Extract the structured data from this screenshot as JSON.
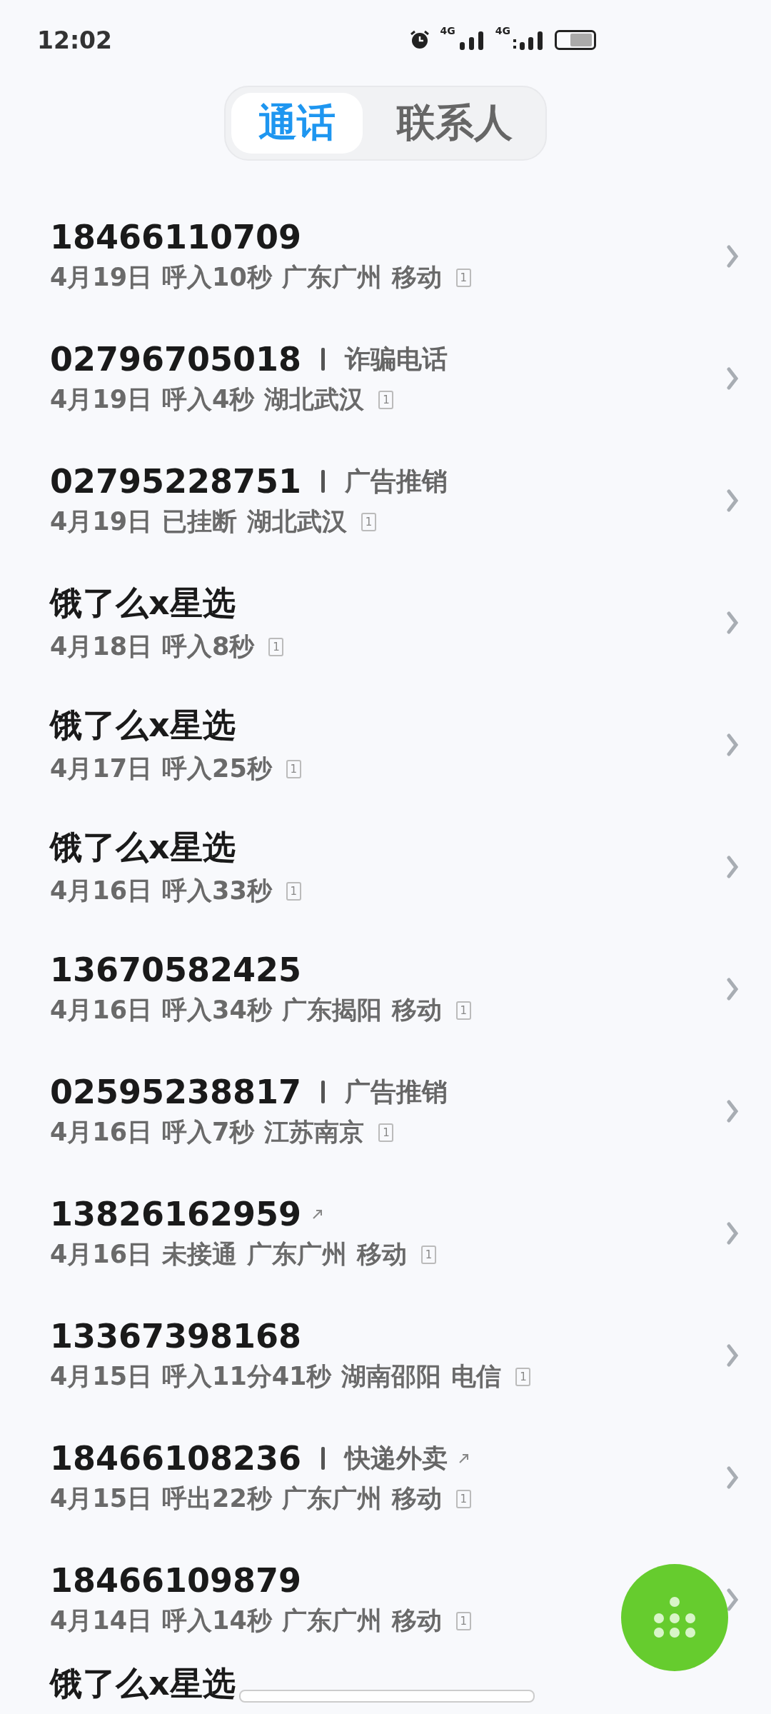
{
  "status_bar": {
    "time": "12:02",
    "network_1": "4G",
    "network_2": "4G"
  },
  "tabs": [
    {
      "label": "通话",
      "selected": true
    },
    {
      "label": "联系人",
      "selected": false
    }
  ],
  "calls": [
    {
      "name": "18466110709",
      "date": "4月19日",
      "status": "呼入10秒",
      "location": "广东广州",
      "carrier": "移动",
      "sim": "1",
      "outgoing": false
    },
    {
      "name": "02796705018",
      "tag": "诈骗电话",
      "date": "4月19日",
      "status": "呼入4秒",
      "location": "湖北武汉",
      "sim": "1",
      "outgoing": false
    },
    {
      "name": "02795228751",
      "tag": "广告推销",
      "date": "4月19日",
      "status": "已挂断",
      "location": "湖北武汉",
      "sim": "1",
      "outgoing": false
    },
    {
      "name": "饿了么x星选",
      "date": "4月18日",
      "status": "呼入8秒",
      "sim": "1",
      "outgoing": false
    },
    {
      "name": "饿了么x星选",
      "date": "4月17日",
      "status": "呼入25秒",
      "sim": "1",
      "outgoing": false
    },
    {
      "name": "饿了么x星选",
      "date": "4月16日",
      "status": "呼入33秒",
      "sim": "1",
      "outgoing": false
    },
    {
      "name": "13670582425",
      "date": "4月16日",
      "status": "呼入34秒",
      "location": "广东揭阳",
      "carrier": "移动",
      "sim": "1",
      "outgoing": false
    },
    {
      "name": "02595238817",
      "tag": "广告推销",
      "date": "4月16日",
      "status": "呼入7秒",
      "location": "江苏南京",
      "sim": "1",
      "outgoing": false
    },
    {
      "name": "13826162959",
      "date": "4月16日",
      "status": "未接通",
      "location": "广东广州",
      "carrier": "移动",
      "sim": "1",
      "outgoing": true
    },
    {
      "name": "13367398168",
      "date": "4月15日",
      "status": "呼入11分41秒",
      "location": "湖南邵阳",
      "carrier": "电信",
      "sim": "1",
      "outgoing": false
    },
    {
      "name": "18466108236",
      "tag": "快递外卖",
      "date": "4月15日",
      "status": "呼出22秒",
      "location": "广东广州",
      "carrier": "移动",
      "sim": "1",
      "outgoing": true
    },
    {
      "name": "18466109879",
      "date": "4月14日",
      "status": "呼入14秒",
      "location": "广东广州",
      "carrier": "移动",
      "sim": "1",
      "outgoing": false
    }
  ],
  "partial_row": {
    "name": "饿了么x星选"
  }
}
